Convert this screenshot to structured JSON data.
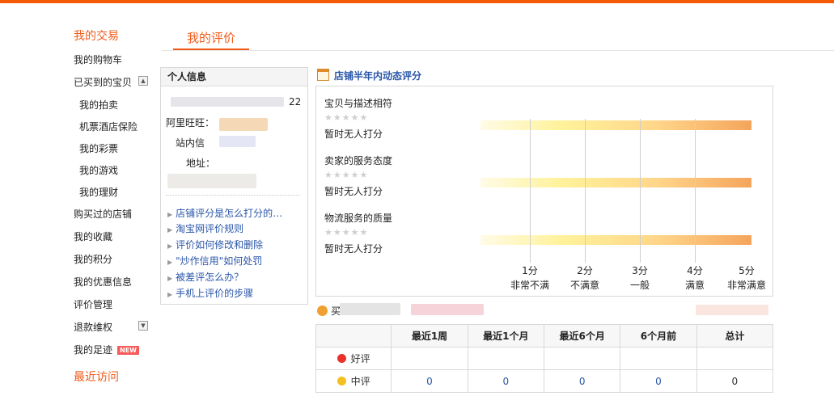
{
  "sidebar": {
    "section1": "我的交易",
    "items": [
      {
        "label": "我的购物车"
      },
      {
        "label": "已买到的宝贝"
      },
      {
        "label": "我的拍卖"
      },
      {
        "label": "机票酒店保险"
      },
      {
        "label": "我的彩票"
      },
      {
        "label": "我的游戏"
      },
      {
        "label": "我的理财"
      },
      {
        "label": "购买过的店铺"
      },
      {
        "label": "我的收藏"
      },
      {
        "label": "我的积分"
      },
      {
        "label": "我的优惠信息"
      },
      {
        "label": "评价管理"
      },
      {
        "label": "退款维权"
      },
      {
        "label": "我的足迹"
      }
    ],
    "new_badge": "NEW",
    "section2": "最近访问"
  },
  "tab": {
    "label": "我的评价"
  },
  "info": {
    "title": "个人信息",
    "id_suffix": "22",
    "wangwang_label": "阿里旺旺：",
    "message_label": "站内信",
    "address_label": "地址：",
    "links": [
      "店铺评分是怎么打分的…",
      "淘宝网评价规则",
      "评价如何修改和删除",
      "\"炒作信用\"如何处罚",
      "被差评怎么办？",
      "手机上评价的步骤"
    ]
  },
  "rating": {
    "title": "店铺半年内动态评分",
    "stars": "★★★★★",
    "items": [
      {
        "label": "宝贝与描述相符",
        "status": "暂时无人打分"
      },
      {
        "label": "卖家的服务态度",
        "status": "暂时无人打分"
      },
      {
        "label": "物流服务的质量",
        "status": "暂时无人打分"
      }
    ],
    "scale": [
      {
        "score": "1分",
        "desc": "非常不满"
      },
      {
        "score": "2分",
        "desc": "不满意"
      },
      {
        "score": "3分",
        "desc": "一般"
      },
      {
        "score": "4分",
        "desc": "满意"
      },
      {
        "score": "5分",
        "desc": "非常满意"
      }
    ]
  },
  "table": {
    "user_prefix": "买",
    "headers": [
      "",
      "最近1周",
      "最近1个月",
      "最近6个月",
      "6个月前",
      "总计"
    ],
    "rows": [
      {
        "label": "好评",
        "values": [
          "",
          "",
          "",
          "",
          ""
        ]
      },
      {
        "label": "中评",
        "values": [
          "0",
          "0",
          "0",
          "0",
          "0"
        ]
      }
    ]
  },
  "colors": {
    "accent": "#f25a1a",
    "link": "#2a56a8",
    "topbar": "#f55a07"
  }
}
